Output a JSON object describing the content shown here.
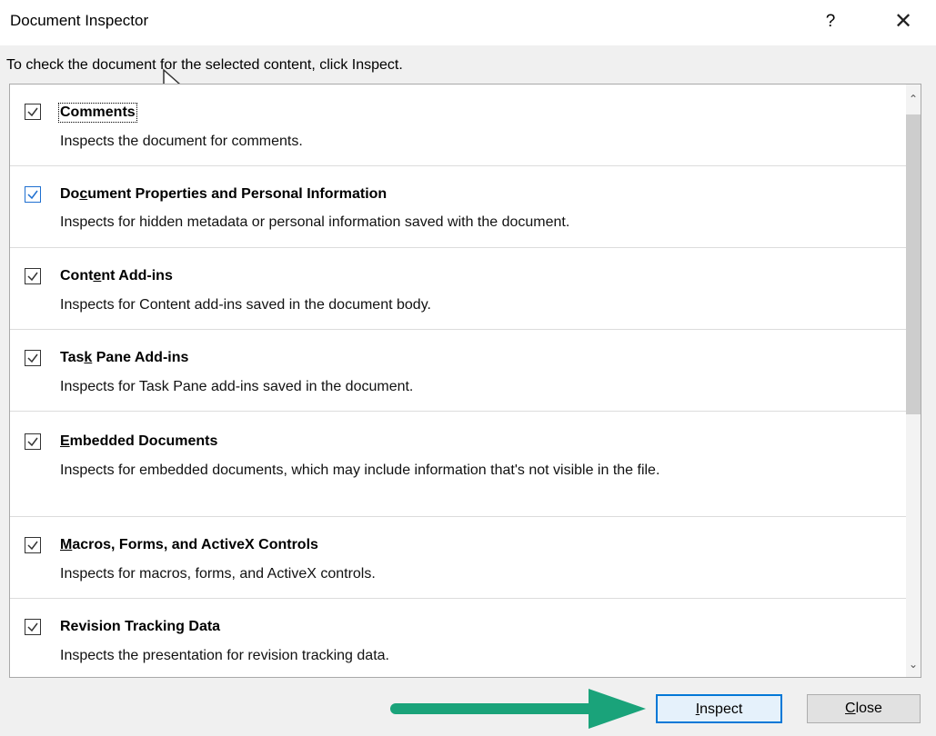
{
  "dialog": {
    "title": "Document Inspector",
    "help_label": "?",
    "close_icon": "close-icon",
    "instruction": "To check the document for the selected content, click Inspect."
  },
  "items": [
    {
      "title_pre": "",
      "title_u": "",
      "title_post": "Comments",
      "desc": "Inspects the document for comments.",
      "checked": true
    },
    {
      "title_pre": "Do",
      "title_u": "c",
      "title_post": "ument Properties and Personal Information",
      "desc": "Inspects for hidden metadata or personal information saved with the document.",
      "checked": true
    },
    {
      "title_pre": "Cont",
      "title_u": "e",
      "title_post": "nt Add-ins",
      "desc": "Inspects for Content add-ins saved in the document body.",
      "checked": true
    },
    {
      "title_pre": "Tas",
      "title_u": "k",
      "title_post": " Pane Add-ins",
      "desc": "Inspects for Task Pane add-ins saved in the document.",
      "checked": true
    },
    {
      "title_pre": "",
      "title_u": "E",
      "title_post": "mbedded Documents",
      "desc": "Inspects for embedded documents, which may include information that's not visible in the file.",
      "checked": true
    },
    {
      "title_pre": "",
      "title_u": "M",
      "title_post": "acros, Forms, and ActiveX Controls",
      "desc": "Inspects for macros, forms, and ActiveX controls.",
      "checked": true
    },
    {
      "title_pre": "",
      "title_u": "",
      "title_post": "Revision Tracking Data",
      "desc": "Inspects the presentation for revision tracking data.",
      "checked": true
    }
  ],
  "buttons": {
    "inspect_u": "I",
    "inspect_rest": "nspect",
    "close_u": "C",
    "close_rest": "lose"
  },
  "colors": {
    "accent": "#0078d7",
    "arrow": "#1aa37a"
  }
}
